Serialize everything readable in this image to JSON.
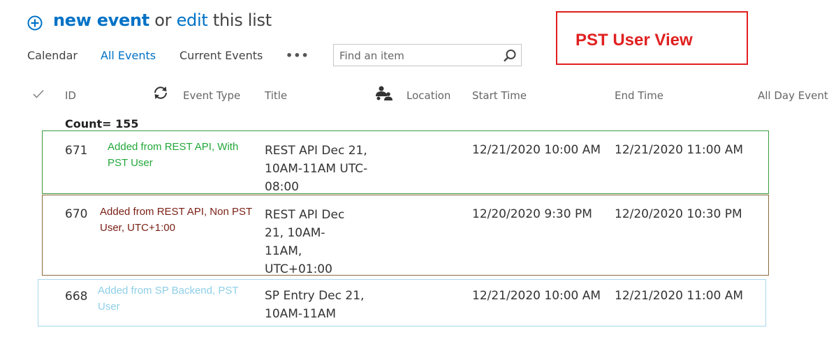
{
  "header": {
    "new_event": "new event",
    "or": "or",
    "edit": "edit",
    "this_list": "this list"
  },
  "views": {
    "calendar": "Calendar",
    "all_events": "All Events",
    "current_events": "Current Events",
    "more": "•••"
  },
  "search": {
    "placeholder": "Find an item"
  },
  "callout": {
    "text": "PST User View",
    "color": "#e02020"
  },
  "columns": {
    "id": "ID",
    "event_type": "Event Type",
    "title": "Title",
    "location": "Location",
    "start_time": "Start Time",
    "end_time": "End Time",
    "all_day_event": "All Day Event"
  },
  "count": "Count= 155",
  "rows": [
    {
      "id": "671",
      "title": "REST API Dec 21, 10AM-11AM UTC-08:00",
      "start": "12/21/2020 10:00 AM",
      "end": "12/21/2020 11:00 AM",
      "note": "Added from REST API, With PST User",
      "color": "#22a83a"
    },
    {
      "id": "670",
      "title": "REST API Dec 21, 10AM- 11AM, UTC+01:00",
      "start": "12/20/2020 9:30 PM",
      "end": "12/20/2020 10:30 PM",
      "note": "Added from REST API, Non PST User, UTC+1:00",
      "color": "#7a1f14"
    },
    {
      "id": "668",
      "title": "SP Entry Dec 21, 10AM-11AM",
      "start": "12/21/2020 10:00 AM",
      "end": "12/21/2020 11:00 AM",
      "note": "Added from SP Backend, PST User",
      "color": "#8ecfe8"
    }
  ],
  "colors": {
    "accent": "#0072c6",
    "row1_border": "#3c9a3c",
    "row2_border": "#8b6a3c",
    "row3_border": "#a8d8ec"
  }
}
